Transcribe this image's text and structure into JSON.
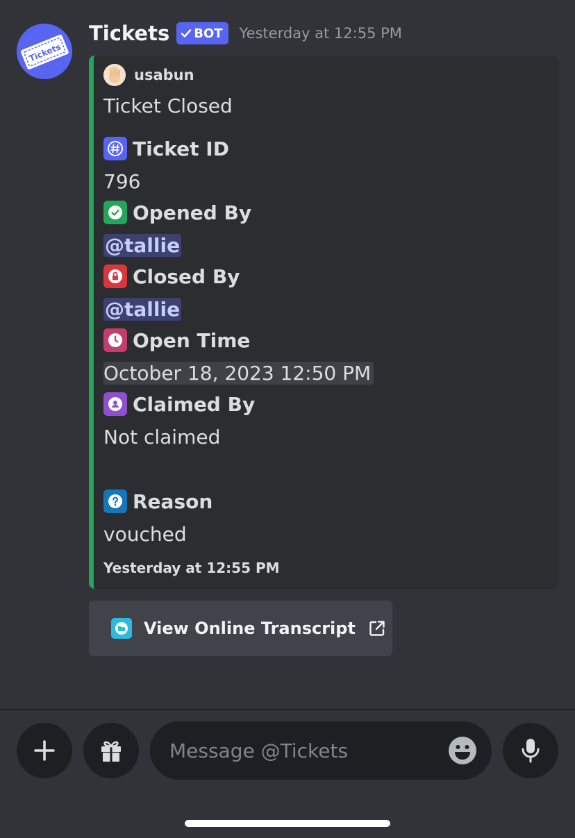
{
  "message": {
    "author": "Tickets",
    "bot_tag": "BOT",
    "timestamp": "Yesterday at 12:55 PM",
    "avatar_text": "Tickets"
  },
  "embed": {
    "accent_color": "#23a55a",
    "author_name": "usabun",
    "title": "Ticket Closed",
    "fields": [
      {
        "name": "Ticket ID",
        "value": "796",
        "icon": "hash-icon",
        "icon_color": "#5865f2"
      },
      {
        "name": "Opened By",
        "value": "@tallie",
        "icon": "check-icon",
        "icon_color": "#23a55a"
      },
      {
        "name": "Closed By",
        "value": "@tallie",
        "icon": "lock-icon",
        "icon_color": "#da373c"
      },
      {
        "name": "Open Time",
        "value": "October 18, 2023 12:50 PM",
        "icon": "clock-icon",
        "icon_color": "#c43e6c"
      },
      {
        "name": "Claimed By",
        "value": "Not claimed",
        "icon": "user-icon",
        "icon_color": "#8e4fd1"
      },
      {
        "name": "Reason",
        "value": "vouched",
        "icon": "question-icon",
        "icon_color": "#1776b9"
      }
    ],
    "footer": "Yesterday at 12:55 PM"
  },
  "button": {
    "label": "View Online Transcript",
    "icon": "folder-icon"
  },
  "composer": {
    "placeholder": "Message @Tickets"
  },
  "colors": {
    "background": "#313338",
    "embed_background": "#2b2d31",
    "blurple": "#5865f2"
  }
}
